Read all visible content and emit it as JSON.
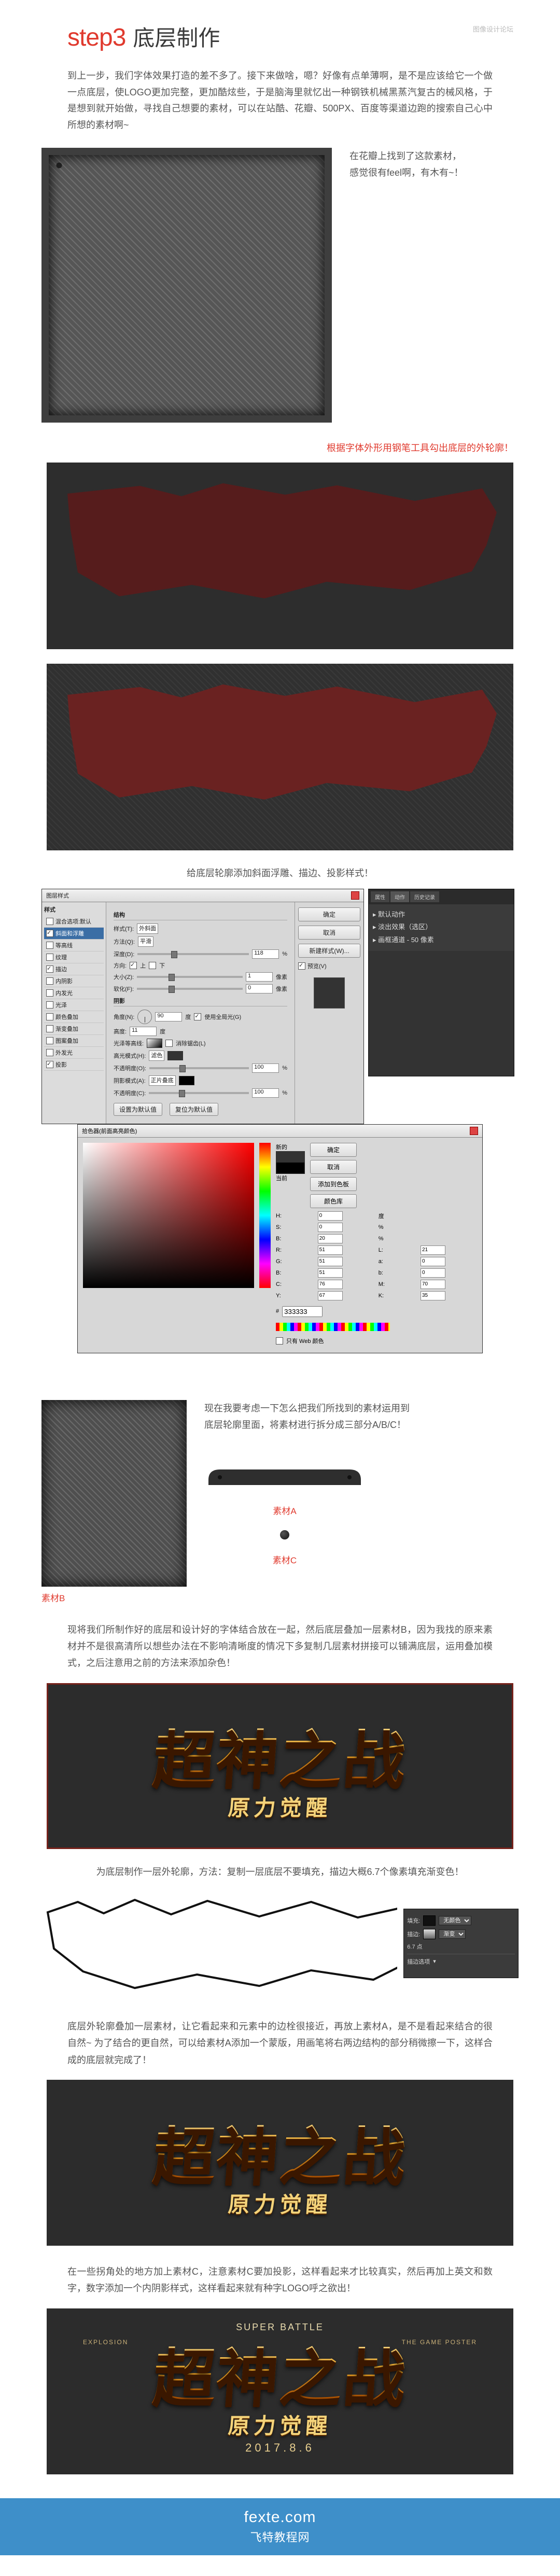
{
  "header": {
    "top_right": "图像设计论坛",
    "step": "step3",
    "title": "底层制作"
  },
  "intro": "到上一步，我们字体效果打造的差不多了。接下来做啥，嗯？好像有点单薄啊，是不是应该给它一个做一点底层，使LOGO更加完整，更加酷炫些，于是脑海里就忆出一种钢铁机械黑蒸汽复古的械风格，于是想到就开始做，寻找自己想要的素材，可以在站酷、花瓣、500PX、百度等渠道边跑的搜索自己心中所想的素材啊~",
  "note1": {
    "l1": "在花瓣上找到了这款素材，",
    "l2": "感觉很有feel啊，有木有~！"
  },
  "cap_red1": "根据字体外形用钢笔工具勾出底层的外轮廓！",
  "cap_mid1": "给底层轮廓添加斜面浮雕、描边、投影样式！",
  "ps1": {
    "title": "图层样式",
    "left_header": "样式",
    "opts": [
      {
        "label": "混合选项:默认",
        "on": false,
        "sel": false
      },
      {
        "label": "斜面和浮雕",
        "on": true,
        "sel": true
      },
      {
        "label": "等高线",
        "on": false,
        "sel": false
      },
      {
        "label": "纹理",
        "on": false,
        "sel": false
      },
      {
        "label": "描边",
        "on": true,
        "sel": false
      },
      {
        "label": "内阴影",
        "on": false,
        "sel": false
      },
      {
        "label": "内发光",
        "on": false,
        "sel": false
      },
      {
        "label": "光泽",
        "on": false,
        "sel": false
      },
      {
        "label": "颜色叠加",
        "on": false,
        "sel": false
      },
      {
        "label": "渐变叠加",
        "on": false,
        "sel": false
      },
      {
        "label": "图案叠加",
        "on": false,
        "sel": false
      },
      {
        "label": "外发光",
        "on": false,
        "sel": false
      },
      {
        "label": "投影",
        "on": true,
        "sel": false
      }
    ],
    "rtab": {
      "ok": "确定",
      "cancel": "取消",
      "newstyle": "新建样式(W)...",
      "preview": "预览(V)"
    },
    "main": {
      "group1": "结构",
      "style_l": "样式(T):",
      "style_v": "外斜面",
      "method_l": "方法(Q):",
      "method_v": "平滑",
      "depth_l": "深度(D):",
      "depth_v": "118",
      "pct": "%",
      "dir_l": "方向:",
      "dir_up": "上",
      "dir_dn": "下",
      "size_l": "大小(Z):",
      "size_v": "1",
      "px": "像素",
      "soft_l": "软化(F):",
      "soft_v": "0",
      "group2": "阴影",
      "angle_l": "角度(N):",
      "angle_v": "90",
      "deg": "度",
      "global": "使用全局光(G)",
      "alt_l": "高度:",
      "alt_v": "11",
      "gloss_l": "光泽等高线:",
      "anti": "消除锯齿(L)",
      "hmode_l": "高光模式(H):",
      "hmode_v": "滤色",
      "hopac_l": "不透明度(O):",
      "hopac_v": "100",
      "smode_l": "阴影模式(A):",
      "smode_v": "正片叠底",
      "sopac_l": "不透明度(C):",
      "sopac_v": "100",
      "reset": "设置为默认值",
      "default": "复位为默认值"
    }
  },
  "picker": {
    "title": "拾色器(前面高亮颜色)",
    "new": "新的",
    "cur": "当前",
    "ok": "确定",
    "cancel": "取消",
    "add": "添加到色板",
    "lib": "颜色库",
    "H": "H:",
    "Hv": "0",
    "Hd": "度",
    "S": "S:",
    "Sv": "0",
    "Sp": "%",
    "B": "B:",
    "Bv": "20",
    "R": "R:",
    "Rv": "51",
    "G": "G:",
    "Gv": "51",
    "Bc": "B:",
    "Bcv": "51",
    "L": "L:",
    "Lv": "21",
    "a": "a:",
    "av": "0",
    "b": "b:",
    "bv": "0",
    "C": "C:",
    "Cv": "76",
    "M": "M:",
    "Mv": "70",
    "Y": "Y:",
    "Yv": "67",
    "K": "K:",
    "Kv": "35",
    "hex_l": "#",
    "hex_v": "333333",
    "web": "只有 Web 颜色"
  },
  "side_panel": {
    "tabs": [
      "属性",
      "动作",
      "历史记录"
    ],
    "s1": "默认动作",
    "s2": "淡出效果（选区）",
    "s3": "画框通道 - 50 像素"
  },
  "split_note": {
    "l1": "现在我要考虑一下怎么把我们所找到的素材运用到",
    "l2": "底层轮廓里面，将素材进行拆分成三部分A/B/C！"
  },
  "mat": {
    "A": "素材A",
    "B": "素材B",
    "C": "素材C"
  },
  "para2": "现将我们所制作好的底层和设计好的字体结合放在一起，然后底层叠加一层素材B，因为我找的原来素材并不是很高清所以想些办法在不影响清晰度的情况下多复制几层素材拼接可以铺满底层，运用叠加模式，之后注意用之前的方法来添加杂色！",
  "logo": {
    "main": "超神之战",
    "sub": "原力觉醒",
    "eng": "SUPER BATTLE",
    "side_l": "EXPLOSION",
    "side_r": "THE GAME POSTER",
    "date": "2017.8.6"
  },
  "cap_outline": "为底层制作一层外轮廓，方法：复制一层底层不要填充，描边大概6.7个像素填充渐变色！",
  "mini_ps": {
    "lbl1": "填充:",
    "v1": "无颜色",
    "lbl2": "描边:",
    "v2": "渐变",
    "lbl3": "6.7 点",
    "lbl4": "描边选项"
  },
  "para3": "底层外轮廓叠加一层素材，让它看起来和元素中的边栓很接近，再放上素材A，是不是看起来结合的很自然~ 为了结合的更自然，可以给素材A添加一个蒙版，用画笔将右两边结构的部分稍微擦一下，这样合成的底层就完成了！",
  "para4": "在一些拐角处的地方加上素材C，注意素材C要加投影，这样看起来才比较真实，然后再加上英文和数字，数字添加一个内阴影样式，这样看起来就有种字LOGO呼之欲出！",
  "footer": {
    "d": "fexte.com",
    "s": "飞特教程网"
  }
}
